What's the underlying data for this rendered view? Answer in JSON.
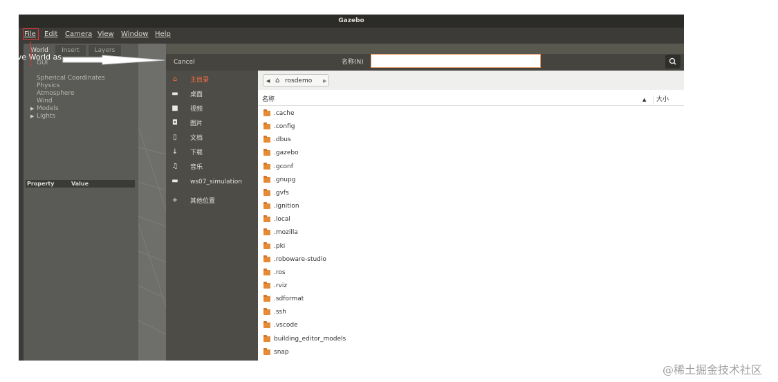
{
  "window": {
    "title": "Gazebo"
  },
  "menu": [
    "File",
    "Edit",
    "Camera",
    "View",
    "Window",
    "Help"
  ],
  "left_panel": {
    "tabs": [
      "World",
      "Insert",
      "Layers"
    ],
    "tree": [
      "GUI",
      "Spherical Coordinates",
      "Physics",
      "Atmosphere",
      "Wind",
      "Models",
      "Lights"
    ],
    "property_header": {
      "property": "Property",
      "value": "Value"
    }
  },
  "annotation": {
    "label": "Save World as"
  },
  "dialog": {
    "cancel_label": "Cancel",
    "name_label": "名称(N)",
    "name_value": "",
    "places": [
      {
        "label": "主目录",
        "icon": "home-icon",
        "glyph": "⌂"
      },
      {
        "label": "桌面",
        "icon": "folder-icon",
        "glyph": "▬"
      },
      {
        "label": "视频",
        "icon": "video-icon",
        "glyph": "■"
      },
      {
        "label": "图片",
        "icon": "camera-icon",
        "glyph": "◘"
      },
      {
        "label": "文档",
        "icon": "document-icon",
        "glyph": "▯"
      },
      {
        "label": "下载",
        "icon": "download-icon",
        "glyph": "↓"
      },
      {
        "label": "音乐",
        "icon": "music-icon",
        "glyph": "♫"
      },
      {
        "label": "ws07_simulation",
        "icon": "folder-icon",
        "glyph": "▬"
      },
      {
        "label": "其他位置",
        "icon": "plus-icon",
        "glyph": "+"
      }
    ],
    "path": {
      "current": "rosdemo"
    },
    "columns": {
      "name": "名称",
      "size": "大小"
    },
    "files": [
      ".cache",
      ".config",
      ".dbus",
      ".gazebo",
      ".gconf",
      ".gnupg",
      ".gvfs",
      ".ignition",
      ".local",
      ".mozilla",
      ".pki",
      ".roboware-studio",
      ".ros",
      ".rviz",
      ".sdformat",
      ".ssh",
      ".vscode",
      "building_editor_models",
      "snap"
    ]
  },
  "watermark": "@稀土掘金技术社区",
  "colors": {
    "accent": "#ff7043",
    "folder": "#e58a35",
    "highlight_box": "#e53935"
  }
}
